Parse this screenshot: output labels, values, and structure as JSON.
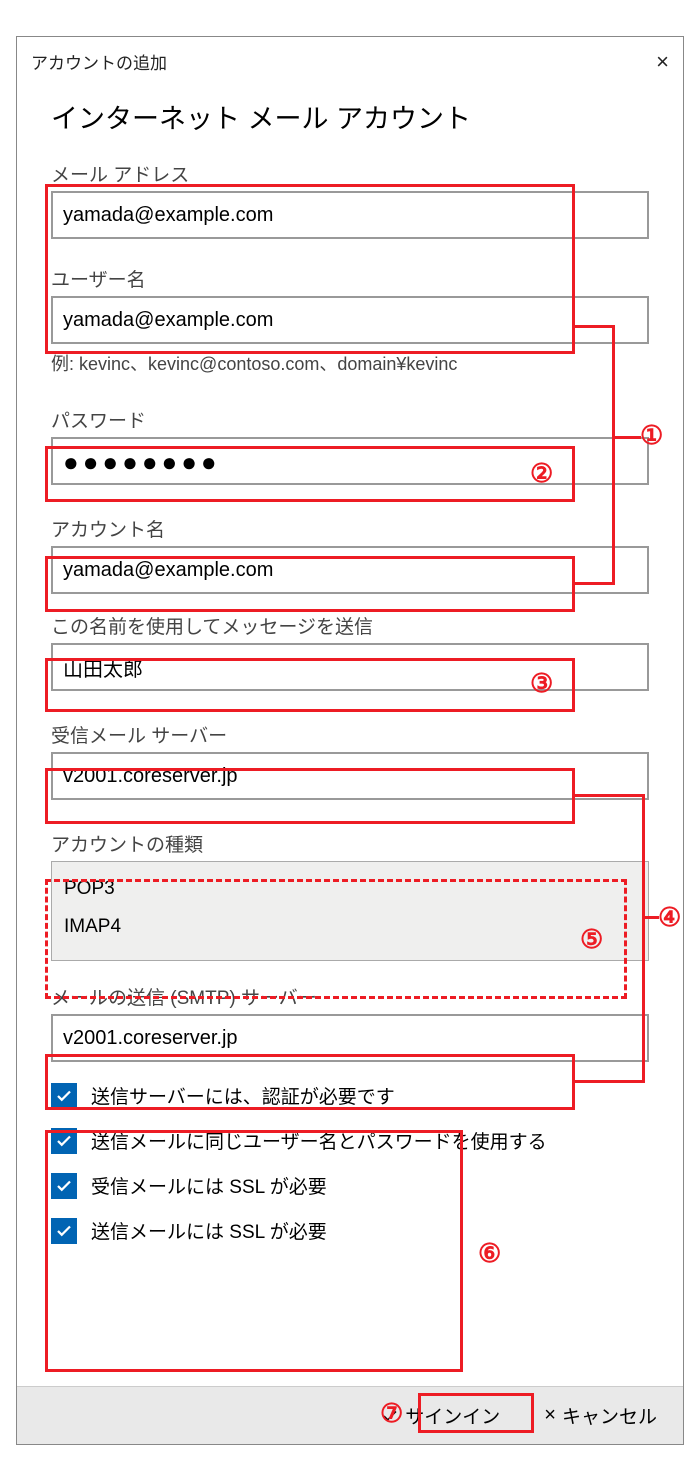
{
  "header": {
    "title": "アカウントの追加"
  },
  "page_title": "インターネット メール アカウント",
  "fields": {
    "email": {
      "label": "メール アドレス",
      "value": "yamada@example.com"
    },
    "user": {
      "label": "ユーザー名",
      "value": "yamada@example.com",
      "hint": "例: kevinc、kevinc@contoso.com、domain¥kevinc"
    },
    "password": {
      "label": "パスワード",
      "mask": "●●●●●●●●"
    },
    "account_name": {
      "label": "アカウント名",
      "value": "yamada@example.com"
    },
    "display_name": {
      "label": "この名前を使用してメッセージを送信",
      "value": "山田太郎"
    },
    "incoming": {
      "label": "受信メール サーバー",
      "value": "v2001.coreserver.jp"
    },
    "account_type": {
      "label": "アカウントの種類",
      "options": [
        "POP3",
        "IMAP4"
      ]
    },
    "smtp": {
      "label": "メールの送信 (SMTP) サーバー",
      "value": "v2001.coreserver.jp"
    }
  },
  "checks": [
    "送信サーバーには、認証が必要です",
    "送信メールに同じユーザー名とパスワードを使用する",
    "受信メールには SSL が必要",
    "送信メールには SSL が必要"
  ],
  "footer": {
    "signin": "サインイン",
    "cancel": "キャンセル"
  },
  "annotations": {
    "n1": "①",
    "n2": "②",
    "n3": "③",
    "n4": "④",
    "n5": "⑤",
    "n6": "⑥",
    "n7": "⑦"
  }
}
